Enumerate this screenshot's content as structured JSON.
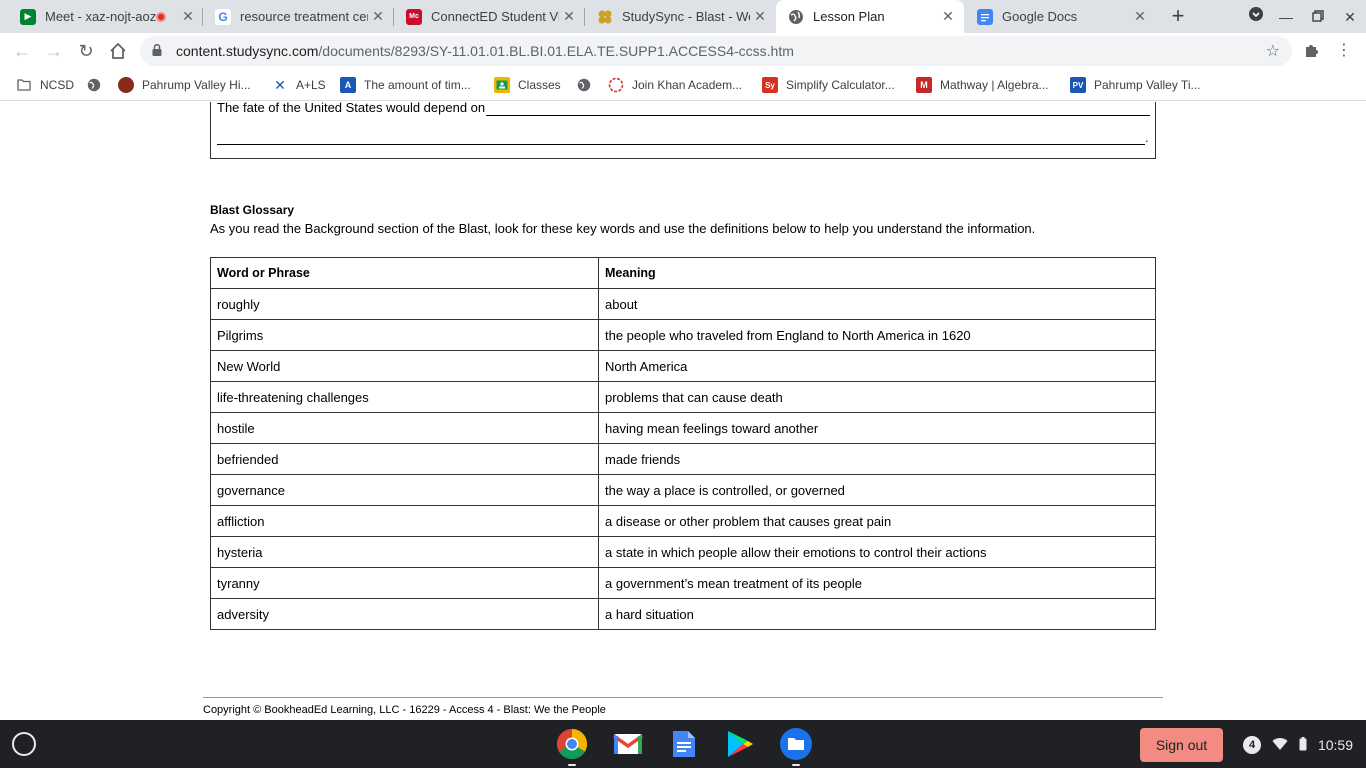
{
  "browser": {
    "tabs": [
      {
        "title": "Meet - xaz-nojt-aoz",
        "icon": "google-meet-icon"
      },
      {
        "title": "resource treatment cent",
        "icon": "google-g-icon"
      },
      {
        "title": "ConnectED Student Vie",
        "icon": "mcgraw-hill-icon"
      },
      {
        "title": "StudySync - Blast - We t",
        "icon": "studysync-icon"
      },
      {
        "title": "Lesson Plan",
        "icon": "globe-icon",
        "active": true
      },
      {
        "title": "Google Docs",
        "icon": "google-docs-icon"
      }
    ],
    "url_host": "content.studysync.com",
    "url_path": "/documents/8293/SY-11.01.01.BL.BI.01.ELA.TE.SUPP1.ACCESS4-ccss.htm",
    "bookmarks": [
      {
        "label": "NCSD",
        "icon": "folder-icon"
      },
      {
        "label": "",
        "icon": "globe-icon"
      },
      {
        "label": "Pahrump Valley Hi...",
        "icon": "pahrump-logo-icon"
      },
      {
        "label": "A+LS",
        "icon": "x-logo-icon"
      },
      {
        "label": "The amount of tim...",
        "icon": "a-logo-icon"
      },
      {
        "label": "Classes",
        "icon": "classroom-icon"
      },
      {
        "label": "",
        "icon": "globe-icon"
      },
      {
        "label": "Join Khan Academ...",
        "icon": "khan-academy-icon"
      },
      {
        "label": "Simplify Calculator...",
        "icon": "symbolab-icon"
      },
      {
        "label": "Mathway | Algebra...",
        "icon": "mathway-icon"
      },
      {
        "label": "Pahrump Valley Ti...",
        "icon": "pv-logo-icon"
      }
    ]
  },
  "page": {
    "answer_prompt": "The fate of the United States would depend on",
    "answer_period": ".",
    "glossary_title": "Blast Glossary",
    "glossary_intro": "As you read the Background section of the Blast, look for these key words and use the definitions below to help you understand the information.",
    "glossary_headers": [
      "Word or Phrase",
      "Meaning"
    ],
    "glossary_rows": [
      [
        "roughly",
        "about"
      ],
      [
        "Pilgrims",
        "the people who traveled from England to North America in 1620"
      ],
      [
        "New World",
        "North America"
      ],
      [
        "life-threatening challenges",
        "problems that can cause death"
      ],
      [
        "hostile",
        "having mean feelings toward another"
      ],
      [
        "befriended",
        "made friends"
      ],
      [
        "governance",
        "the way a place is controlled, or governed"
      ],
      [
        "affliction",
        "a disease or other problem that causes great pain"
      ],
      [
        "hysteria",
        "a state in which people allow their emotions to control their actions"
      ],
      [
        "tyranny",
        "a government’s mean treatment of its people"
      ],
      [
        "adversity",
        "a hard situation"
      ]
    ],
    "footer": "Copyright © BookheadEd Learning, LLC - 16229 - Access 4 - Blast: We the People"
  },
  "shelf": {
    "apps": [
      "chrome-icon",
      "gmail-icon",
      "google-docs-icon",
      "play-store-icon",
      "files-icon"
    ],
    "sign_out_label": "Sign out",
    "notification_count": "4",
    "time": "10:59"
  },
  "colors": {
    "tabstrip_bg": "#dee1e6",
    "shelf_bg": "#202124",
    "sign_out_bg": "#f28b82"
  }
}
